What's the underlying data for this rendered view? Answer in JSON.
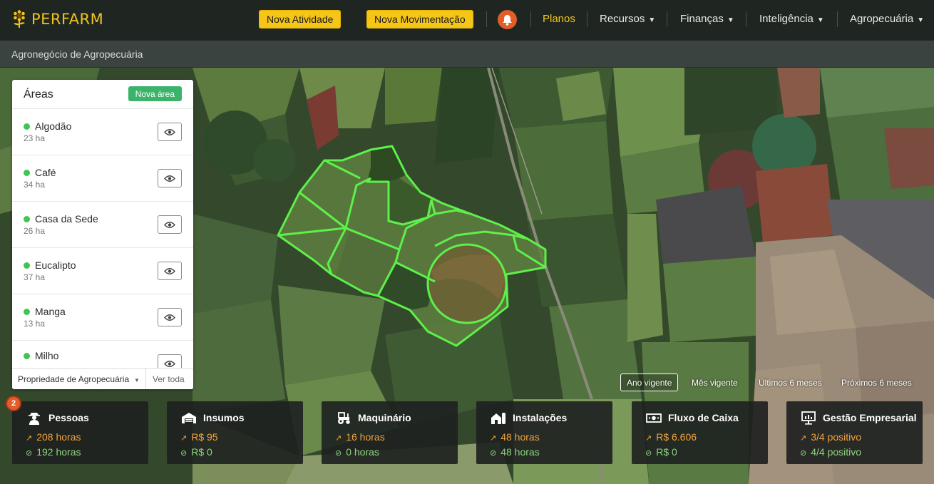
{
  "header": {
    "brand": "PERFARM",
    "btn_activity": "Nova Atividade",
    "btn_movement": "Nova Movimentação",
    "nav": {
      "planos": "Planos",
      "recursos": "Recursos",
      "financas": "Finanças",
      "inteligencia": "Inteligência",
      "agropecuaria": "Agropecuária"
    }
  },
  "subheader": {
    "title": "Agronegócio de Agropecuária"
  },
  "areas": {
    "title": "Áreas",
    "new_button": "Nova área",
    "items": [
      {
        "name": "Algodão",
        "size": "23 ha"
      },
      {
        "name": "Café",
        "size": "34 ha"
      },
      {
        "name": "Casa da Sede",
        "size": "26 ha"
      },
      {
        "name": "Eucalipto",
        "size": "37 ha"
      },
      {
        "name": "Manga",
        "size": "13 ha"
      },
      {
        "name": "Milho",
        "size": ""
      }
    ],
    "property": "Propriedade de Agropecuária",
    "view_all": "Ver toda"
  },
  "period": {
    "current_year": "Ano vigente",
    "current_month": "Mês vigente",
    "last_6": "Últimos 6 meses",
    "next_6": "Próximos 6 meses"
  },
  "notifications": {
    "count": "2"
  },
  "cards": [
    {
      "title": "Pessoas",
      "line1": "208 horas",
      "line2": "192 horas"
    },
    {
      "title": "Insumos",
      "line1": "R$ 95",
      "line2": "R$ 0"
    },
    {
      "title": "Maquinário",
      "line1": "16 horas",
      "line2": "0 horas"
    },
    {
      "title": "Instalações",
      "line1": "48 horas",
      "line2": "48 horas"
    },
    {
      "title": "Fluxo de Caixa",
      "line1": "R$ 6.606",
      "line2": "R$ 0"
    },
    {
      "title": "Gestão Empresarial",
      "line1": "3/4 positivo",
      "line2": "4/4 positivo"
    }
  ],
  "colors": {
    "accent": "#f5c518",
    "plot_outline": "#5ef04a",
    "positive": "#8dd37d",
    "planned": "#f2a33b",
    "alert": "#e35d2a",
    "button_green": "#3bb36a"
  }
}
